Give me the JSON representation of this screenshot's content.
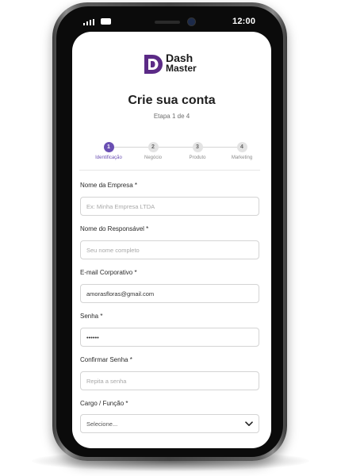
{
  "status_bar": {
    "time": "12:00"
  },
  "brand": {
    "line1": "Dash",
    "line2": "Master",
    "accent": "#5b2a86"
  },
  "header": {
    "title": "Crie sua conta",
    "step_text": "Etapa 1 de 4"
  },
  "stepper": {
    "steps": [
      {
        "number": "1",
        "label": "Identificação",
        "active": true
      },
      {
        "number": "2",
        "label": "Negócio",
        "active": false
      },
      {
        "number": "3",
        "label": "Produto",
        "active": false
      },
      {
        "number": "4",
        "label": "Marketing",
        "active": false
      }
    ],
    "active_color": "#6a4fb3"
  },
  "form": {
    "company": {
      "label": "Nome da Empresa *",
      "placeholder": "Ex: Minha Empresa LTDA",
      "value": ""
    },
    "responsible": {
      "label": "Nome do Responsável *",
      "placeholder": "Seu nome completo",
      "value": ""
    },
    "email": {
      "label": "E-mail Corporativo *",
      "placeholder": "",
      "value": "amorasfloras@gmail.com"
    },
    "password": {
      "label": "Senha *",
      "value": "••••••"
    },
    "confirm_password": {
      "label": "Confirmar Senha *",
      "placeholder": "Repita a senha",
      "value": ""
    },
    "role": {
      "label": "Cargo / Função *",
      "selected": "Selecione...",
      "icon": "chevron-down-icon"
    }
  }
}
